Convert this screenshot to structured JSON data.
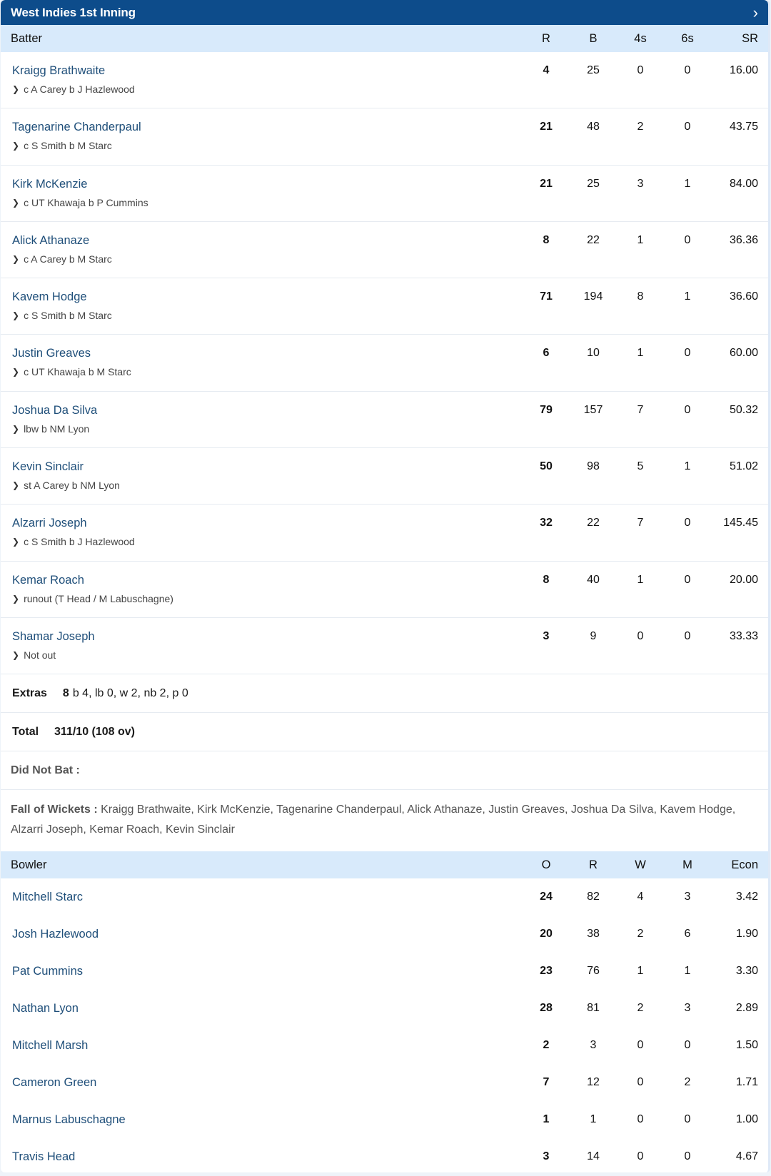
{
  "header": {
    "title": "West Indies 1st Inning",
    "chevron_icon": "chevron-right-icon"
  },
  "batting": {
    "columns": {
      "name": "Batter",
      "r": "R",
      "b": "B",
      "fours": "4s",
      "sixes": "6s",
      "sr": "SR"
    },
    "rows": [
      {
        "name": "Kraigg Brathwaite",
        "dismissal": "c A Carey b J Hazlewood",
        "r": "4",
        "b": "25",
        "fours": "0",
        "sixes": "0",
        "sr": "16.00"
      },
      {
        "name": "Tagenarine Chanderpaul",
        "dismissal": "c S Smith b M Starc",
        "r": "21",
        "b": "48",
        "fours": "2",
        "sixes": "0",
        "sr": "43.75"
      },
      {
        "name": "Kirk McKenzie",
        "dismissal": "c UT Khawaja b P Cummins",
        "r": "21",
        "b": "25",
        "fours": "3",
        "sixes": "1",
        "sr": "84.00"
      },
      {
        "name": "Alick Athanaze",
        "dismissal": "c A Carey b M Starc",
        "r": "8",
        "b": "22",
        "fours": "1",
        "sixes": "0",
        "sr": "36.36"
      },
      {
        "name": "Kavem Hodge",
        "dismissal": "c S Smith b M Starc",
        "r": "71",
        "b": "194",
        "fours": "8",
        "sixes": "1",
        "sr": "36.60"
      },
      {
        "name": "Justin Greaves",
        "dismissal": "c UT Khawaja b M Starc",
        "r": "6",
        "b": "10",
        "fours": "1",
        "sixes": "0",
        "sr": "60.00"
      },
      {
        "name": "Joshua Da Silva",
        "dismissal": "lbw b NM Lyon",
        "r": "79",
        "b": "157",
        "fours": "7",
        "sixes": "0",
        "sr": "50.32"
      },
      {
        "name": "Kevin Sinclair",
        "dismissal": "st A Carey b NM Lyon",
        "r": "50",
        "b": "98",
        "fours": "5",
        "sixes": "1",
        "sr": "51.02"
      },
      {
        "name": "Alzarri Joseph",
        "dismissal": "c S Smith b J Hazlewood",
        "r": "32",
        "b": "22",
        "fours": "7",
        "sixes": "0",
        "sr": "145.45"
      },
      {
        "name": "Kemar Roach",
        "dismissal": "runout (T Head / M Labuschagne)",
        "r": "8",
        "b": "40",
        "fours": "1",
        "sixes": "0",
        "sr": "20.00"
      },
      {
        "name": "Shamar Joseph",
        "dismissal": "Not out",
        "r": "3",
        "b": "9",
        "fours": "0",
        "sixes": "0",
        "sr": "33.33"
      }
    ],
    "extras": {
      "label": "Extras",
      "total": "8",
      "detail": "b 4, lb 0, w 2, nb 2, p 0"
    },
    "total": {
      "label": "Total",
      "value": "311/10 (108 ov)"
    },
    "did_not_bat": {
      "label": "Did Not Bat :"
    },
    "fall_of_wickets": {
      "label": "Fall of Wickets :",
      "value": "Kraigg Brathwaite, Kirk McKenzie, Tagenarine Chanderpaul, Alick Athanaze, Justin Greaves, Joshua Da Silva, Kavem Hodge, Alzarri Joseph, Kemar Roach, Kevin Sinclair"
    }
  },
  "bowling": {
    "columns": {
      "name": "Bowler",
      "o": "O",
      "r": "R",
      "w": "W",
      "m": "M",
      "econ": "Econ"
    },
    "rows": [
      {
        "name": "Mitchell Starc",
        "o": "24",
        "r": "82",
        "w": "4",
        "m": "3",
        "econ": "3.42"
      },
      {
        "name": "Josh Hazlewood",
        "o": "20",
        "r": "38",
        "w": "2",
        "m": "6",
        "econ": "1.90"
      },
      {
        "name": "Pat Cummins",
        "o": "23",
        "r": "76",
        "w": "1",
        "m": "1",
        "econ": "3.30"
      },
      {
        "name": "Nathan Lyon",
        "o": "28",
        "r": "81",
        "w": "2",
        "m": "3",
        "econ": "2.89"
      },
      {
        "name": "Mitchell Marsh",
        "o": "2",
        "r": "3",
        "w": "0",
        "m": "0",
        "econ": "1.50"
      },
      {
        "name": "Cameron Green",
        "o": "7",
        "r": "12",
        "w": "0",
        "m": "2",
        "econ": "1.71"
      },
      {
        "name": "Marnus Labuschagne",
        "o": "1",
        "r": "1",
        "w": "0",
        "m": "0",
        "econ": "1.00"
      },
      {
        "name": "Travis Head",
        "o": "3",
        "r": "14",
        "w": "0",
        "m": "0",
        "econ": "4.67"
      }
    ]
  },
  "colors": {
    "header_bg": "#0d4c8b",
    "table_head_bg": "#d8eafb",
    "player_link": "#1e4e79"
  }
}
